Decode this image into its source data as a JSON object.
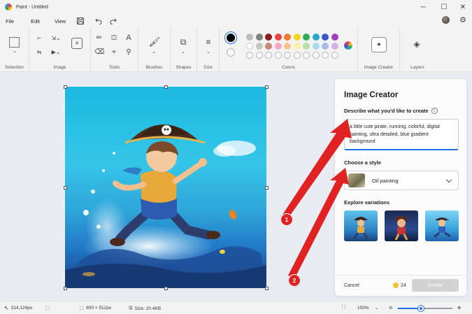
{
  "window": {
    "title": "Paint - Untitled",
    "controls": [
      "─",
      "☐",
      "✕"
    ]
  },
  "menu": {
    "items": [
      "File",
      "Edit",
      "View"
    ]
  },
  "ribbon": {
    "groups": [
      "Selection",
      "Image",
      "Tools",
      "Brushes",
      "Shapes",
      "Size",
      "Colors",
      "Image Creator",
      "Layers"
    ],
    "palette_row1": [
      "#bdbdbd",
      "#808080",
      "#8c1c1c",
      "#e8453c",
      "#f07b2d",
      "#f7d31b",
      "#35a853",
      "#27a7c8",
      "#3557c9",
      "#a13fb8"
    ],
    "palette_row2": [
      "#ffffff",
      "#c5c5c5",
      "#c88a7a",
      "#f4a9c7",
      "#f7c48a",
      "#f9f1a8",
      "#b8e2a6",
      "#a6dcef",
      "#a8b9ea",
      "#d1b2e1"
    ],
    "primary_color": "#000000",
    "secondary_color": "#ffffff"
  },
  "status": {
    "cursor": "314,124px",
    "canvas_size": "800 × 512px",
    "file_size": "Size: 20.4KB",
    "zoom": "100%",
    "zoom_fraction": 0.42
  },
  "image_creator": {
    "title": "Image Creator",
    "prompt_label": "Describe what you'd like to create",
    "prompt_text": "a little cute pirate, running, colorful, digital painting, ultra detailed, blue gradient background",
    "style_label": "Choose a style",
    "style_value": "Oil painting",
    "variations_label": "Explore variations",
    "cancel_label": "Cancel",
    "credits": "24",
    "create_label": "Create"
  },
  "annotations": {
    "badge_1": "1",
    "badge_2": "2",
    "color": "#e02222"
  }
}
